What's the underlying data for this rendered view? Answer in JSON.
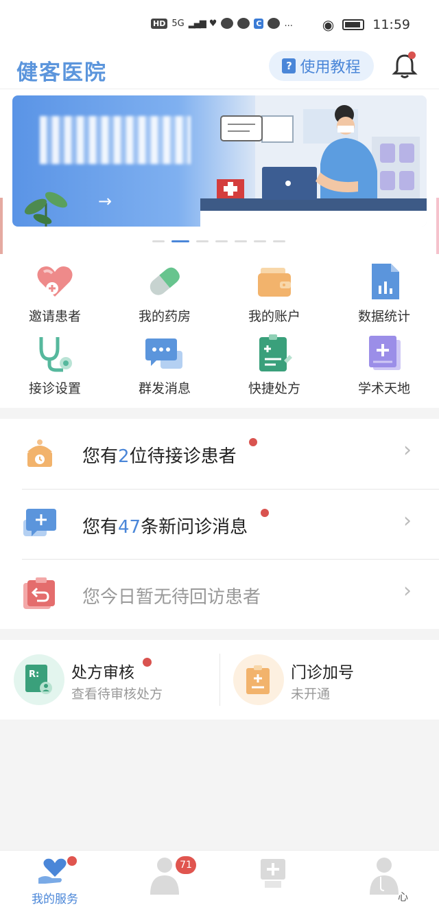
{
  "status_bar": {
    "left_items": [
      "HD",
      "5G",
      "signal",
      "heart",
      "chat",
      "message",
      "app",
      "globe",
      "..."
    ],
    "time": "11:59"
  },
  "header": {
    "title": "健客医院",
    "tutorial_label": "使用教程",
    "tutorial_icon": "?"
  },
  "banner": {
    "arrow": "→",
    "slide_count": 7,
    "active_slide": 2
  },
  "grid": {
    "items": [
      {
        "label": "邀请患者",
        "icon": "invite-heart-icon",
        "color": "#ee8a8a"
      },
      {
        "label": "我的药房",
        "icon": "pill-icon",
        "color": "#67c48e"
      },
      {
        "label": "我的账户",
        "icon": "wallet-icon",
        "color": "#f2b36c"
      },
      {
        "label": "数据统计",
        "icon": "chart-doc-icon",
        "color": "#5b95dc"
      },
      {
        "label": "接诊设置",
        "icon": "stethoscope-icon",
        "color": "#56b89d"
      },
      {
        "label": "群发消息",
        "icon": "chat-bubble-icon",
        "color": "#5b95dc"
      },
      {
        "label": "快捷处方",
        "icon": "prescription-icon",
        "color": "#3aa07b"
      },
      {
        "label": "学术天地",
        "icon": "book-plus-icon",
        "color": "#9b8ee8"
      }
    ]
  },
  "notices": {
    "row1": {
      "prefix": "您有",
      "num": "2",
      "suffix": "位待接诊患者"
    },
    "row2": {
      "prefix": "您有",
      "num": "47",
      "suffix": "条新问诊消息"
    },
    "row3": {
      "text": "您今日暂无待回访患者"
    },
    "chevron": "›"
  },
  "cards": {
    "left": {
      "title": "处方审核",
      "sub": "查看待审核处方",
      "icon_text": "R:"
    },
    "right": {
      "title": "门诊加号",
      "sub": "未开通"
    }
  },
  "tabbar": {
    "tab1_label": "我的服务",
    "badge": "71",
    "tab4_label": "心"
  },
  "colors": {
    "accent": "#4a86d8",
    "alert": "#d9534f"
  }
}
